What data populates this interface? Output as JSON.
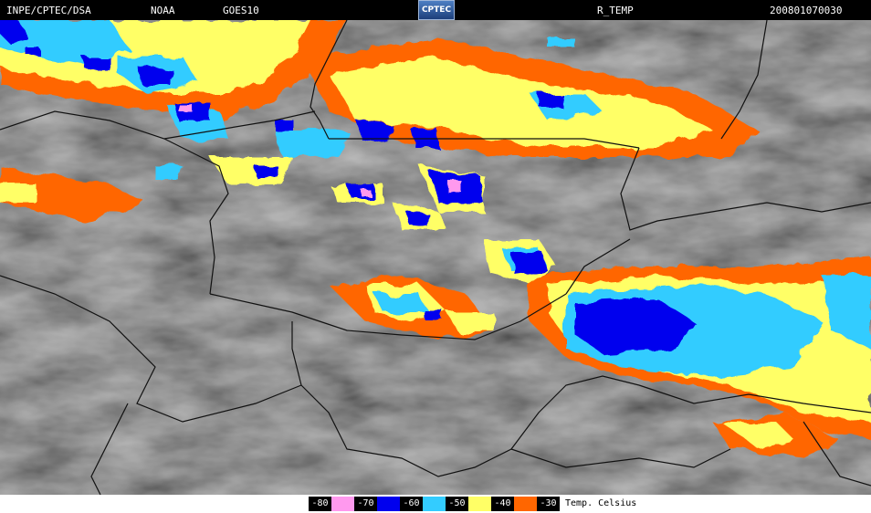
{
  "header": {
    "agency": "INPE/CPTEC/DSA",
    "partner": "NOAA",
    "satellite": "GOES10",
    "logo_text": "CPTEC",
    "product": "R_TEMP",
    "timestamp": "200801070030"
  },
  "legend": {
    "items": [
      {
        "label": "-80",
        "color": "#ff99ee"
      },
      {
        "label": "-70",
        "color": "#0000ee"
      },
      {
        "label": "-60",
        "color": "#33ccff"
      },
      {
        "label": "-50",
        "color": "#ffff66"
      },
      {
        "label": "-40",
        "color": "#ff6600"
      },
      {
        "label": "-30",
        "color": "#ffffff"
      }
    ],
    "unit": "Temp. Celsius"
  },
  "colors": {
    "background_cloud": "#3c3c3c",
    "boundary_lines": "#111111"
  }
}
